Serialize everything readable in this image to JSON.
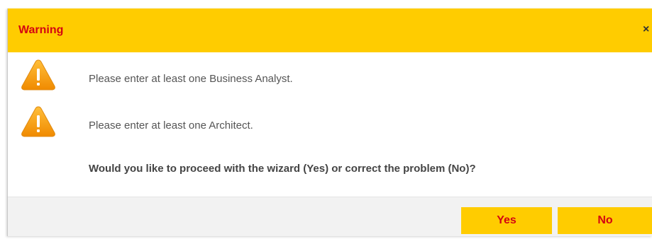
{
  "dialog": {
    "title": "Warning",
    "close_label": "×",
    "messages": [
      {
        "icon": "warning-icon",
        "text": "Please enter at least one Business Analyst."
      },
      {
        "icon": "warning-icon",
        "text": "Please enter at least one Architect."
      }
    ],
    "question": "Would you like to proceed with the wizard (Yes) or correct the problem (No)?",
    "buttons": {
      "yes_label": "Yes",
      "no_label": "No"
    }
  },
  "colors": {
    "header_bg": "#ffcc00",
    "title_text": "#d40511",
    "button_bg": "#ffcc00",
    "button_text": "#d40511",
    "footer_bg": "#f2f2f2",
    "icon_fill": "#f7a51c"
  }
}
